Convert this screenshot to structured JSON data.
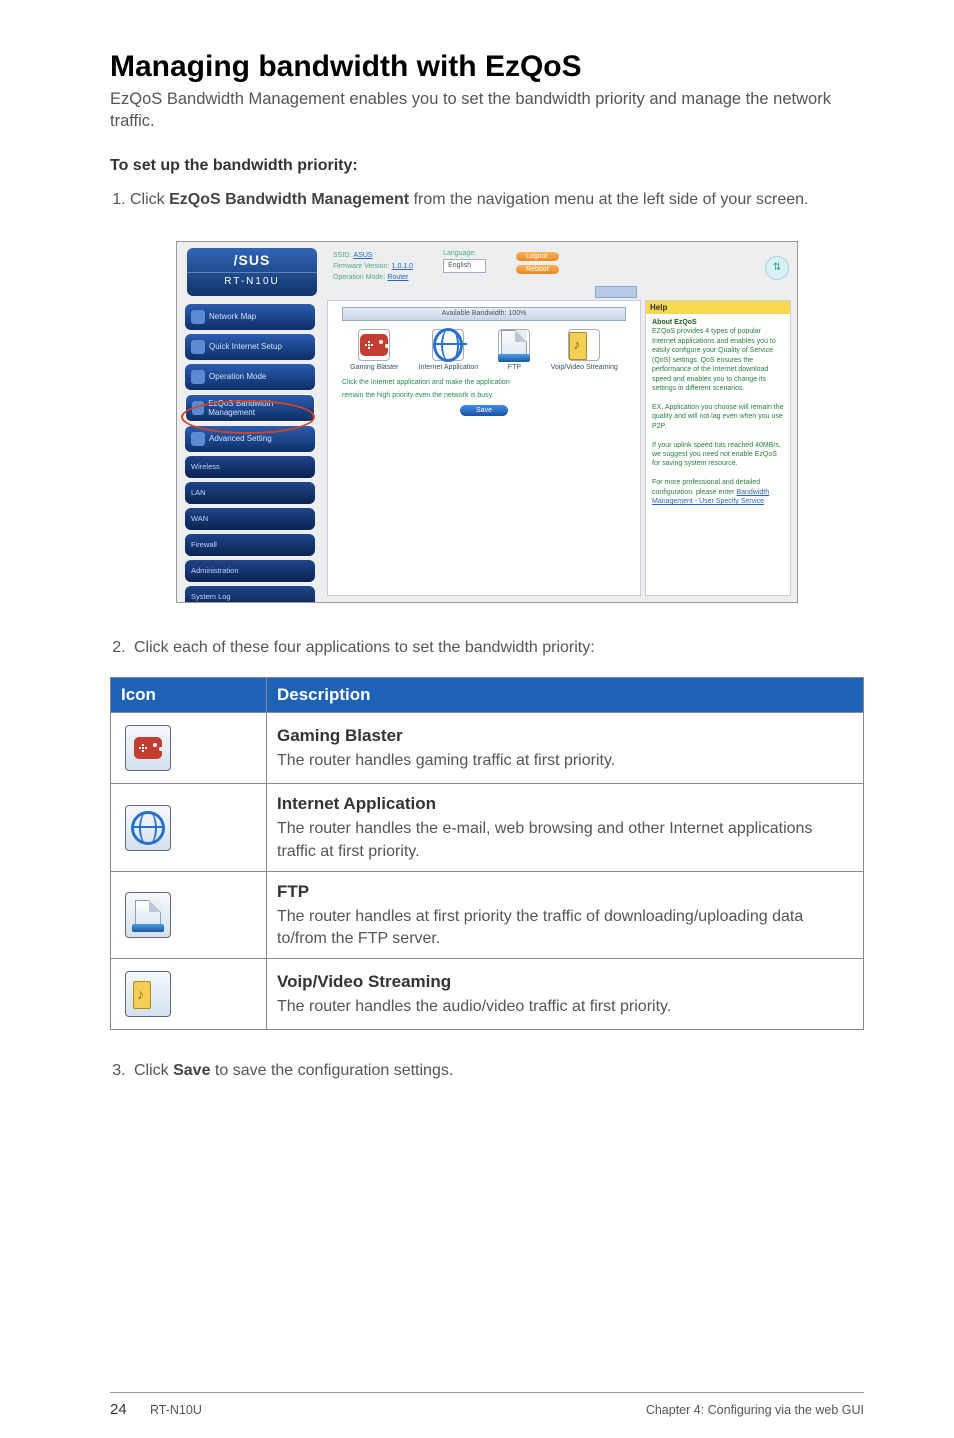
{
  "heading": "Managing bandwidth with EzQoS",
  "intro": "EzQoS Bandwidth Management enables you to set the bandwidth priority and manage the network traffic.",
  "subhead": "To set up the bandwidth priority:",
  "step1_before": "Click ",
  "step1_bold": "EzQoS Bandwidth Management",
  "step1_after": " from the navigation menu at the left side of your screen.",
  "step2": "Click each of these four applications to set the bandwidth priority:",
  "step3_before": "Click ",
  "step3_bold": "Save",
  "step3_after": " to save the configuration settings.",
  "table": {
    "headers": [
      "Icon",
      "Description"
    ],
    "rows": [
      {
        "title": "Gaming Blaster",
        "desc": "The router handles gaming traffic at first priority."
      },
      {
        "title": "Internet Application",
        "desc": "The router handles the e-mail, web browsing and other Internet applications traffic at first priority."
      },
      {
        "title": "FTP",
        "desc": "The router handles at first priority the traffic of downloading/uploading data to/from the FTP server."
      },
      {
        "title": "Voip/Video Streaming",
        "desc": "The router handles the audio/video traffic at first priority."
      }
    ]
  },
  "shot": {
    "brand": "/SUS",
    "model": "RT-N10U",
    "ssid_label": "SSID:",
    "ssid_value": "ASUS",
    "fw_label": "Firmware Version:",
    "fw_value": "1.0.1.0",
    "opmode_label": "Operation Mode:",
    "opmode_value": "Router",
    "lang_label": "Language:",
    "lang_value": "English",
    "logout": "Logout",
    "reboot": "Reboot",
    "sidebar": {
      "network_map": "Network Map",
      "quick_setup": "Quick Internet Setup",
      "op_mode": "Operation Mode",
      "ezqos": "EzQoS Bandwidth Management",
      "adv": "Advanced Setting",
      "wireless": "Wireless",
      "lan": "LAN",
      "wan": "WAN",
      "firewall": "Firewall",
      "admin": "Administration",
      "syslog": "System Log"
    },
    "bwbar": "Available Bandwidth: 100%",
    "apps": {
      "gaming": "Gaming Blaster",
      "internet": "Internet Application",
      "ftp": "FTP",
      "voip": "Voip/Video Streaming"
    },
    "info1": "Click the Internet application and make the application",
    "info2": "remain the high priority even the network is busy.",
    "save": "Save",
    "help_title": "Help",
    "help_about": "About EzQoS",
    "help_body1": "EZQoS provides 4 types of popular Internet applications and enables you to easily configure your Quality of Service (QoS) settings. QoS ensures the performance of the Internet download speed and enables you to change its settings in different scenarios.",
    "help_body2": "EX. Application you choose will remain the quality and will not lag even when you use P2P.",
    "help_body3": "If your uplink speed has reached 40MB/s, we suggest you need not enable EzQoS for saving system resource.",
    "help_body4a": "For more professional and detailed configuration, please enter ",
    "help_link1": "Bandwidth Management - User Specify Service"
  },
  "footer": {
    "page": "24",
    "model": "RT-N10U",
    "chapter": "Chapter 4: Configuring via the web GUI"
  }
}
